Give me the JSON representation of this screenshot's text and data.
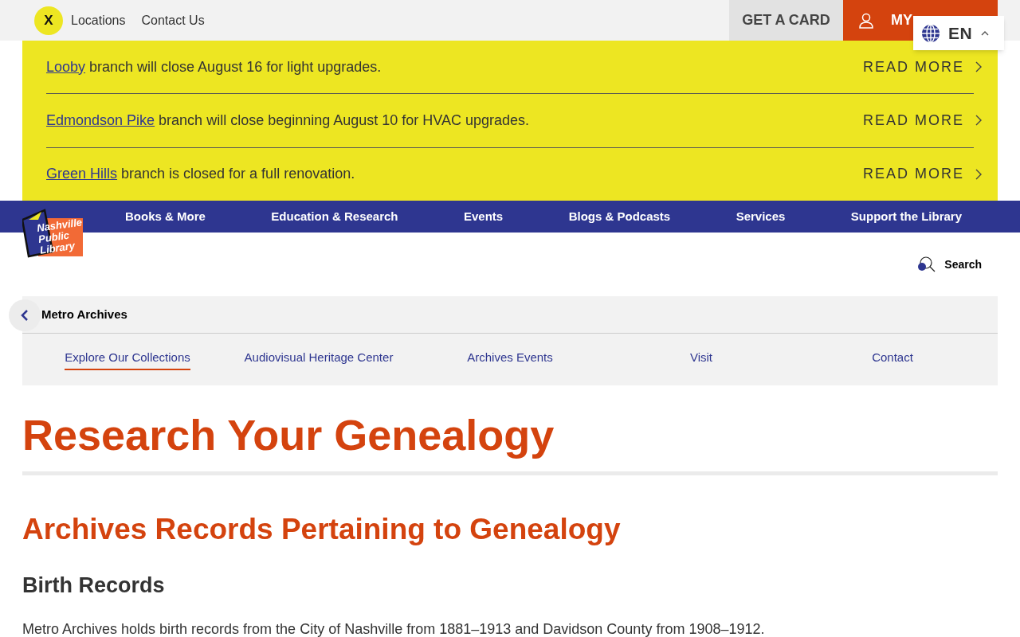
{
  "utility_bar": {
    "close_label": "X",
    "links": [
      "Locations",
      "Contact Us"
    ],
    "get_card": "GET A CARD",
    "my_account": "MY",
    "language": {
      "code": "EN",
      "expanded": true
    }
  },
  "alerts": [
    {
      "link": "Looby",
      "text": "branch will close August 16 for light upgrades.",
      "action": "READ MORE"
    },
    {
      "link": "Edmondson Pike",
      "text": "branch will close beginning August 10 for HVAC upgrades.",
      "action": "READ MORE"
    },
    {
      "link": "Green Hills",
      "text": "branch is closed for a full renovation.",
      "action": "READ MORE"
    }
  ],
  "logo": {
    "lines": [
      "Nashville",
      "Public",
      "Library"
    ]
  },
  "main_nav": [
    "Books & More",
    "Education & Research",
    "Events",
    "Blogs & Podcasts",
    "Services",
    "Support the Library"
  ],
  "search": {
    "label": "Search"
  },
  "section_nav": {
    "title": "Metro Archives",
    "tabs": [
      {
        "label": "Explore Our Collections",
        "selected": true
      },
      {
        "label": "Audiovisual Heritage Center",
        "selected": false
      },
      {
        "label": "Archives Events",
        "selected": false
      },
      {
        "label": "Visit",
        "selected": false
      },
      {
        "label": "Contact",
        "selected": false
      }
    ]
  },
  "page_title": "Research Your Genealogy",
  "section_heading": "Archives Records Pertaining to Genealogy",
  "subheading": "Birth Records",
  "paragraph": "Metro Archives holds birth records from the City of Nashville from 1881–1913 and Davidson County from 1908–1912."
}
